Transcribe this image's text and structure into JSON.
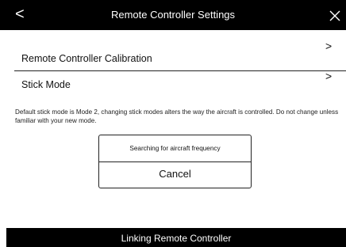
{
  "header": {
    "title": "Remote Controller Settings",
    "back_glyph": "<",
    "back_icon": "chevron-left-icon",
    "close_icon": "close-icon"
  },
  "settings": {
    "items": [
      {
        "label": "Remote Controller Calibration",
        "chevron": ">",
        "icon": "chevron-right-icon"
      },
      {
        "label": "Stick Mode",
        "chevron": ">",
        "icon": "chevron-right-icon"
      }
    ],
    "description": "Default stick mode is Mode 2, changing stick modes alters the way the aircraft is controlled. Do not change unless familiar with your new mode."
  },
  "dialog": {
    "message": "Searching for aircraft frequency",
    "cancel_label": "Cancel"
  },
  "status": {
    "text": "Linking Remote Controller"
  },
  "colors": {
    "bar_background": "#000000",
    "bar_text": "#ffffff",
    "page_background": "#ffffff",
    "text": "#111111"
  }
}
